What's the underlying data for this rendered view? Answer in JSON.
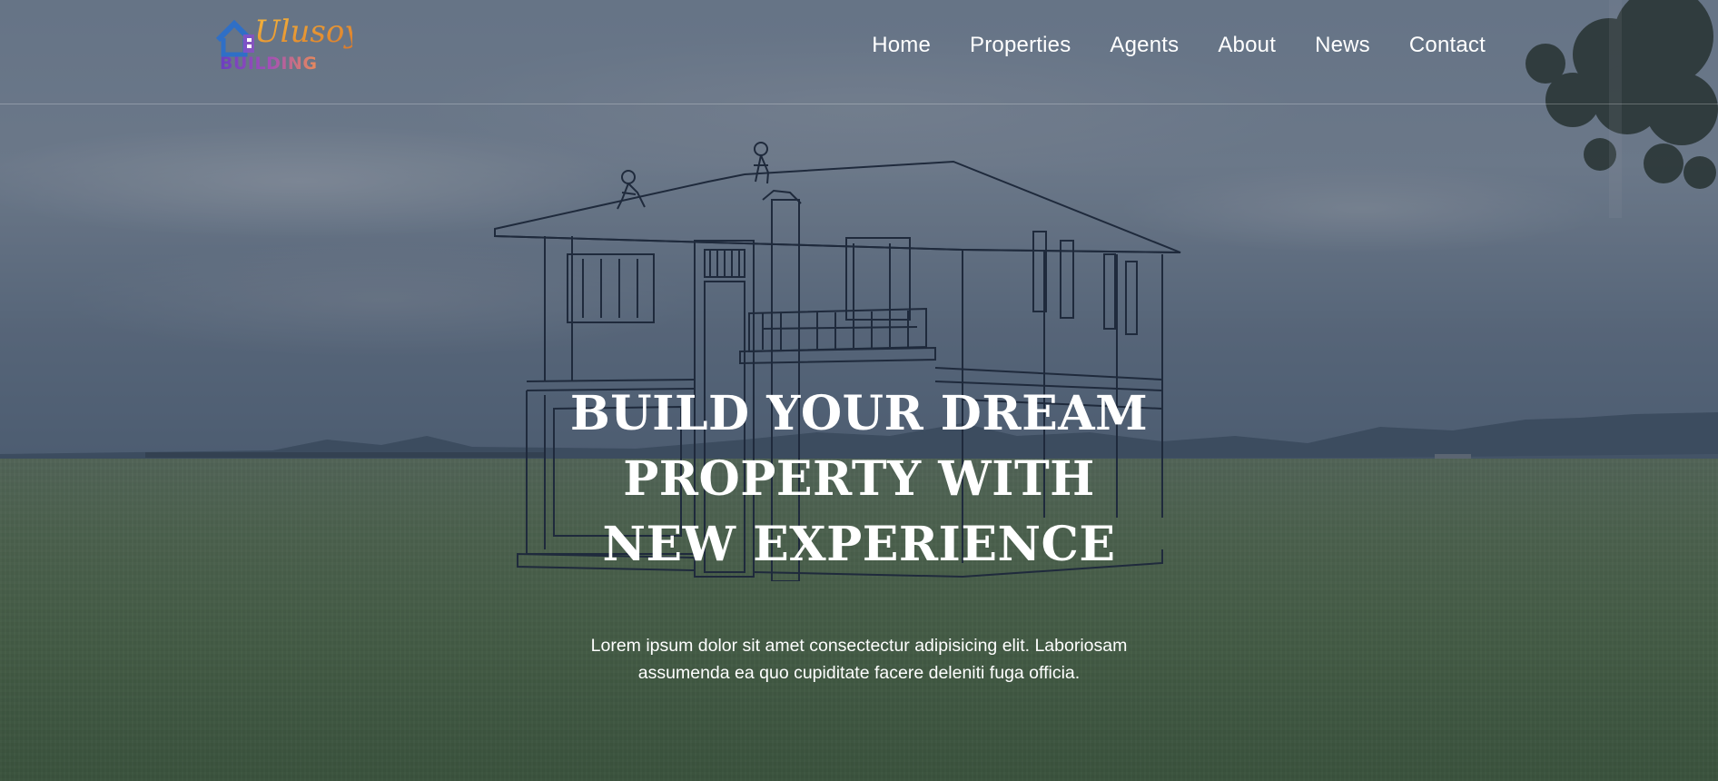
{
  "brand": {
    "logo_script": "Ulusoy",
    "logo_word": "BUILDING",
    "logo_icon": "house-icon"
  },
  "nav": {
    "items": [
      {
        "label": "Home"
      },
      {
        "label": "Properties"
      },
      {
        "label": "Agents"
      },
      {
        "label": "About"
      },
      {
        "label": "News"
      },
      {
        "label": "Contact"
      }
    ]
  },
  "hero": {
    "title": "BUILD YOUR DREAM PROPERTY WITH NEW EXPERIENCE",
    "subtitle": "Lorem ipsum dolor sit amet consectectur adipisicing elit. Laboriosam assumenda ea quo cupiditate facere deleniti fuga officia."
  },
  "colors": {
    "overlay": "#2a3246",
    "text": "#ffffff",
    "logo_blue": "#2f6fc6",
    "logo_orange": "#f0a22a",
    "logo_purple": "#8a4fc7"
  }
}
